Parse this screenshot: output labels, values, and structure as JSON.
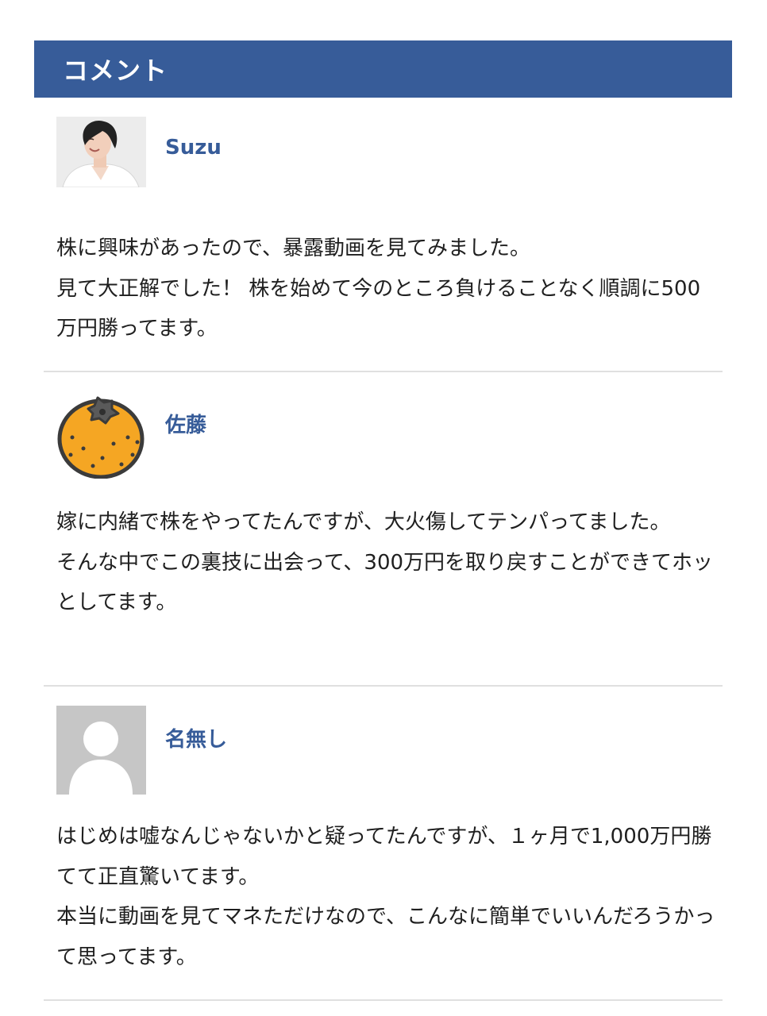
{
  "header": {
    "title": "コメント"
  },
  "comments": [
    {
      "author": "Suzu",
      "avatar_icon": "woman-photo-icon",
      "lines": [
        "株に興味があったので、暴露動画を見てみました。",
        "見て大正解でした！ 株を始めて今のところ負けることなく順調に500万円勝ってます。"
      ]
    },
    {
      "author": "佐藤",
      "avatar_icon": "orange-fruit-icon",
      "lines": [
        "嫁に内緒で株をやってたんですが、大火傷してテンパってました。",
        "そんな中でこの裏技に出会って、300万円を取り戻すことができてホッとしてます。"
      ]
    },
    {
      "author": "名無し",
      "avatar_icon": "default-user-icon",
      "lines": [
        "はじめは嘘なんじゃないかと疑ってたんですが、１ヶ月で1,000万円勝てて正直驚いてます。",
        "本当に動画を見てマネただけなので、こんなに簡単でいいんだろうかって思ってます。"
      ]
    }
  ],
  "colors": {
    "header_bg": "#375c99",
    "author": "#375c99",
    "divider": "#e0e0e0"
  }
}
